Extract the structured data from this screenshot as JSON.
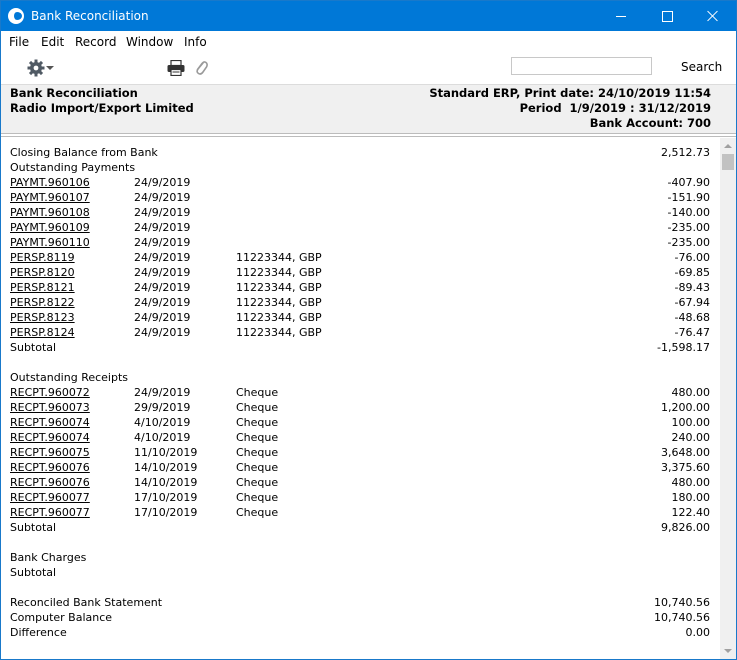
{
  "window": {
    "title": "Bank Reconciliation"
  },
  "menu": [
    "File",
    "Edit",
    "Record",
    "Window",
    "Info"
  ],
  "toolbar": {
    "search_label": "Search",
    "search_value": "",
    "icons": [
      "gear-icon",
      "print-icon",
      "paperclip-icon"
    ]
  },
  "header": {
    "left": [
      "Bank Reconciliation",
      "Radio Import/Export Limited"
    ],
    "right": [
      "Standard ERP, Print date: 24/10/2019 11:54",
      "Period  1/9/2019 : 31/12/2019",
      "Bank Account: 700"
    ]
  },
  "report": {
    "rows": [
      {
        "c1": "Closing Balance from Bank",
        "c2": "",
        "c3": "",
        "amt": "2,512.73",
        "link": false
      },
      {
        "c1": "Outstanding Payments",
        "c2": "",
        "c3": "",
        "amt": "",
        "link": false
      },
      {
        "c1": "PAYMT.960106",
        "c2": "24/9/2019",
        "c3": "",
        "amt": "-407.90",
        "link": true
      },
      {
        "c1": "PAYMT.960107",
        "c2": "24/9/2019",
        "c3": "",
        "amt": "-151.90",
        "link": true
      },
      {
        "c1": "PAYMT.960108",
        "c2": "24/9/2019",
        "c3": "",
        "amt": "-140.00",
        "link": true
      },
      {
        "c1": "PAYMT.960109",
        "c2": "24/9/2019",
        "c3": "",
        "amt": "-235.00",
        "link": true
      },
      {
        "c1": "PAYMT.960110",
        "c2": "24/9/2019",
        "c3": "",
        "amt": "-235.00",
        "link": true
      },
      {
        "c1": "PERSP.8119",
        "c2": "24/9/2019",
        "c3": "11223344, GBP",
        "amt": "-76.00",
        "link": true
      },
      {
        "c1": "PERSP.8120",
        "c2": "24/9/2019",
        "c3": "11223344, GBP",
        "amt": "-69.85",
        "link": true
      },
      {
        "c1": "PERSP.8121",
        "c2": "24/9/2019",
        "c3": "11223344, GBP",
        "amt": "-89.43",
        "link": true
      },
      {
        "c1": "PERSP.8122",
        "c2": "24/9/2019",
        "c3": "11223344, GBP",
        "amt": "-67.94",
        "link": true
      },
      {
        "c1": "PERSP.8123",
        "c2": "24/9/2019",
        "c3": "11223344, GBP",
        "amt": "-48.68",
        "link": true
      },
      {
        "c1": "PERSP.8124",
        "c2": "24/9/2019",
        "c3": "11223344, GBP",
        "amt": "-76.47",
        "link": true
      },
      {
        "c1": "Subtotal",
        "c2": "",
        "c3": "",
        "amt": "-1,598.17",
        "link": false
      },
      {
        "c1": "",
        "c2": "",
        "c3": "",
        "amt": "",
        "link": false
      },
      {
        "c1": "Outstanding Receipts",
        "c2": "",
        "c3": "",
        "amt": "",
        "link": false
      },
      {
        "c1": "RECPT.960072",
        "c2": "24/9/2019",
        "c3": "Cheque",
        "amt": "480.00",
        "link": true
      },
      {
        "c1": "RECPT.960073",
        "c2": "29/9/2019",
        "c3": "Cheque",
        "amt": "1,200.00",
        "link": true
      },
      {
        "c1": "RECPT.960074",
        "c2": "4/10/2019",
        "c3": "Cheque",
        "amt": "100.00",
        "link": true
      },
      {
        "c1": "RECPT.960074",
        "c2": "4/10/2019",
        "c3": "Cheque",
        "amt": "240.00",
        "link": true
      },
      {
        "c1": "RECPT.960075",
        "c2": "11/10/2019",
        "c3": "Cheque",
        "amt": "3,648.00",
        "link": true
      },
      {
        "c1": "RECPT.960076",
        "c2": "14/10/2019",
        "c3": "Cheque",
        "amt": "3,375.60",
        "link": true
      },
      {
        "c1": "RECPT.960076",
        "c2": "14/10/2019",
        "c3": "Cheque",
        "amt": "480.00",
        "link": true
      },
      {
        "c1": "RECPT.960077",
        "c2": "17/10/2019",
        "c3": "Cheque",
        "amt": "180.00",
        "link": true
      },
      {
        "c1": "RECPT.960077",
        "c2": "17/10/2019",
        "c3": "Cheque",
        "amt": "122.40",
        "link": true
      },
      {
        "c1": "Subtotal",
        "c2": "",
        "c3": "",
        "amt": "9,826.00",
        "link": false
      },
      {
        "c1": "",
        "c2": "",
        "c3": "",
        "amt": "",
        "link": false
      },
      {
        "c1": "Bank Charges",
        "c2": "",
        "c3": "",
        "amt": "",
        "link": false
      },
      {
        "c1": "Subtotal",
        "c2": "",
        "c3": "",
        "amt": "",
        "link": false
      },
      {
        "c1": "",
        "c2": "",
        "c3": "",
        "amt": "",
        "link": false
      },
      {
        "c1": "Reconciled Bank Statement",
        "c2": "",
        "c3": "",
        "amt": "10,740.56",
        "link": false
      },
      {
        "c1": "Computer Balance",
        "c2": "",
        "c3": "",
        "amt": "10,740.56",
        "link": false
      },
      {
        "c1": "Difference",
        "c2": "",
        "c3": "",
        "amt": "0.00",
        "link": false
      }
    ]
  }
}
